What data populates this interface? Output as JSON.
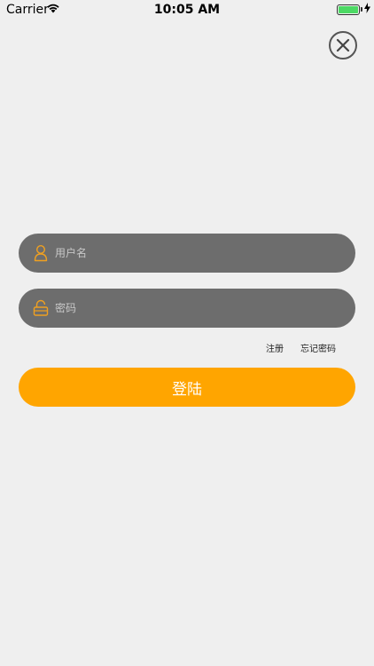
{
  "status_bar": {
    "carrier": "Carrier",
    "time": "10:05 AM",
    "battery_icon": "battery-icon",
    "wifi_icon": "wifi-icon"
  },
  "close_button": {
    "icon": "close-icon"
  },
  "form": {
    "username": {
      "placeholder": "用户名",
      "value": "",
      "icon": "user-icon"
    },
    "password": {
      "placeholder": "密码",
      "value": "",
      "icon": "lock-icon"
    },
    "register_label": "注册",
    "forgot_password_label": "忘记密码",
    "login_label": "登陆"
  },
  "colors": {
    "background": "#efefef",
    "field_background": "#6d6d6d",
    "accent": "#ffa500"
  }
}
